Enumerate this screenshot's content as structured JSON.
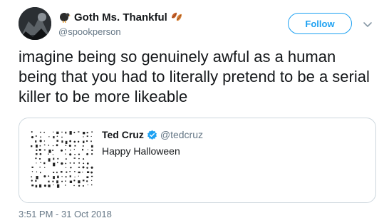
{
  "author": {
    "display_name": "Goth Ms. Thankful",
    "handle": "@spookperson",
    "emoji_left": "turkey-emoji",
    "emoji_right": "fallen-leaves-emoji"
  },
  "follow_label": "Follow",
  "tweet": {
    "text": "imagine being so genuinely awful as a human being that you had to literally pretend to be a serial killer to be more likeable",
    "timestamp": "3:51 PM - 31 Oct 2018"
  },
  "quoted": {
    "name": "Ted Cruz",
    "handle": "@tedcruz",
    "text": "Happy Halloween",
    "verified": true
  },
  "colors": {
    "accent": "#1da1f2",
    "secondary_text": "#657786",
    "border": "#ccd6dd"
  }
}
